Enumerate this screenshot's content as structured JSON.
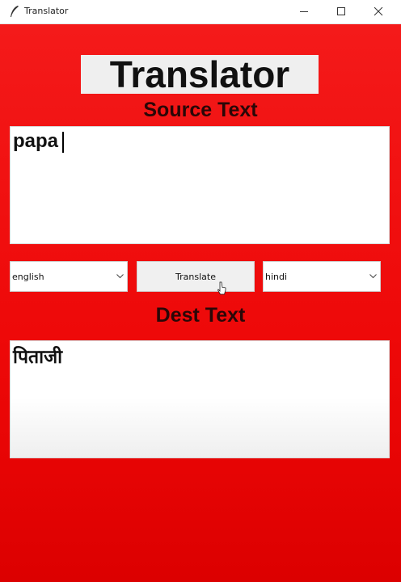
{
  "window": {
    "title": "Translator",
    "icons": [
      "feather-icon",
      "minimize-icon",
      "maximize-icon",
      "close-icon"
    ]
  },
  "app": {
    "heading": "Translator",
    "source_label": "Source Text",
    "dest_label": "Dest Text",
    "source_text": "papa",
    "dest_text": "पिताजी",
    "source_language": "english",
    "dest_language": "hindi",
    "translate_label": "Translate"
  },
  "colors": {
    "background": "#ee0909",
    "heading_bg": "#efefef",
    "label_text": "#2a0707"
  }
}
